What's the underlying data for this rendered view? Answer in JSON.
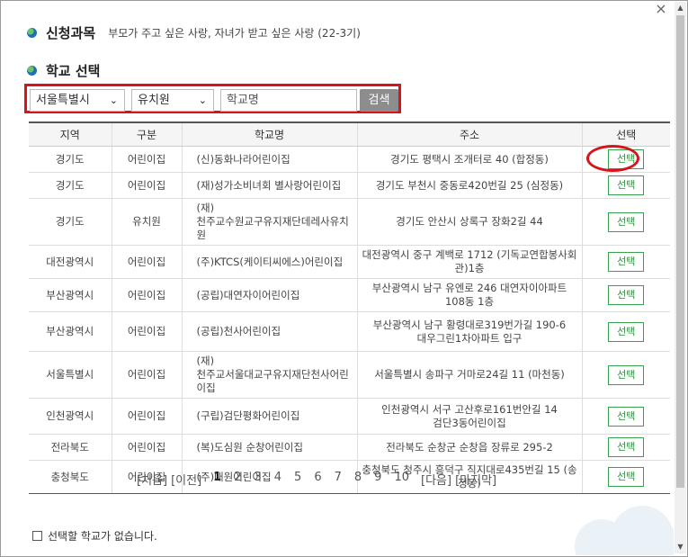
{
  "section1": {
    "title": "신청과목",
    "desc": "부모가 주고 싶은 사랑, 자녀가 받고 싶은 사랑 (22-3기)"
  },
  "section2": {
    "title": "학교 선택"
  },
  "search": {
    "region": "서울특별시",
    "type": "유치원",
    "placeholder": "학교명",
    "button": "검색"
  },
  "table": {
    "headers": [
      "지역",
      "구분",
      "학교명",
      "주소",
      "선택"
    ],
    "rows": [
      {
        "region": "경기도",
        "type": "어린이집",
        "name": "(신)동화나라어린이집",
        "address": "경기도 평택시 조개터로 40 (합정동)",
        "btn": "선택"
      },
      {
        "region": "경기도",
        "type": "어린이집",
        "name": "(재)성가소비녀회 별사랑어린이집",
        "address": "경기도 부천시 중동로420번길 25 (심정동)",
        "btn": "선택"
      },
      {
        "region": "경기도",
        "type": "유치원",
        "name": "(재)\n천주교수원교구유지재단데레사유치원",
        "address": "경기도 안산시 상록구 장화2길 44",
        "btn": "선택"
      },
      {
        "region": "대전광역시",
        "type": "어린이집",
        "name": "(주)KTCS(케이티씨에스)어린이집",
        "address": "대전광역시 중구 계백로 1712 (기독교연합봉사회관)1층",
        "btn": "선택"
      },
      {
        "region": "부산광역시",
        "type": "어린이집",
        "name": "(공립)대연자이어린이집",
        "address": "부산광역시 남구 유엔로 246 대연자이아파트 108동 1층",
        "btn": "선택"
      },
      {
        "region": "부산광역시",
        "type": "어린이집",
        "name": "(공립)천사어린이집",
        "address": "부산광역시 남구 황령대로319번가길 190-6\n대우그린1차아파트 입구",
        "btn": "선택"
      },
      {
        "region": "서울특별시",
        "type": "어린이집",
        "name": "(재)\n천주교서울대교구유지재단천사어린이집",
        "address": "서울특별시 송파구 거마로24길 11 (마천동)",
        "btn": "선택"
      },
      {
        "region": "인천광역시",
        "type": "어린이집",
        "name": "(구립)검단평화어린이집",
        "address": "인천광역시 서구 고산후로161번안길 14\n검단3동어린이집",
        "btn": "선택"
      },
      {
        "region": "전라북도",
        "type": "어린이집",
        "name": "(복)도심원 순창어린이집",
        "address": "전라북도 순창군 순창읍 장류로 295-2",
        "btn": "선택"
      },
      {
        "region": "충청북도",
        "type": "어린이집",
        "name": "(주)대원어린이집",
        "address": "충청북도 청주시 흥덕구 직지대로435번길 15 (송정동)",
        "btn": "선택"
      }
    ]
  },
  "pager": {
    "first": "[처음]",
    "prev": "[이전]",
    "pages": [
      "1",
      "2",
      "3",
      "4",
      "5",
      "6",
      "7",
      "8",
      "9",
      "10"
    ],
    "current": "1",
    "next": "[다음]",
    "last": "[마지막]"
  },
  "none_option": {
    "label": "선택할 학교가 없습니다."
  },
  "colors": {
    "highlight": "#d6151b",
    "select_green": "#36a24c",
    "search_button": "#8d8d8d"
  },
  "icons": {
    "section": "globe-icon",
    "close": "close-icon"
  }
}
